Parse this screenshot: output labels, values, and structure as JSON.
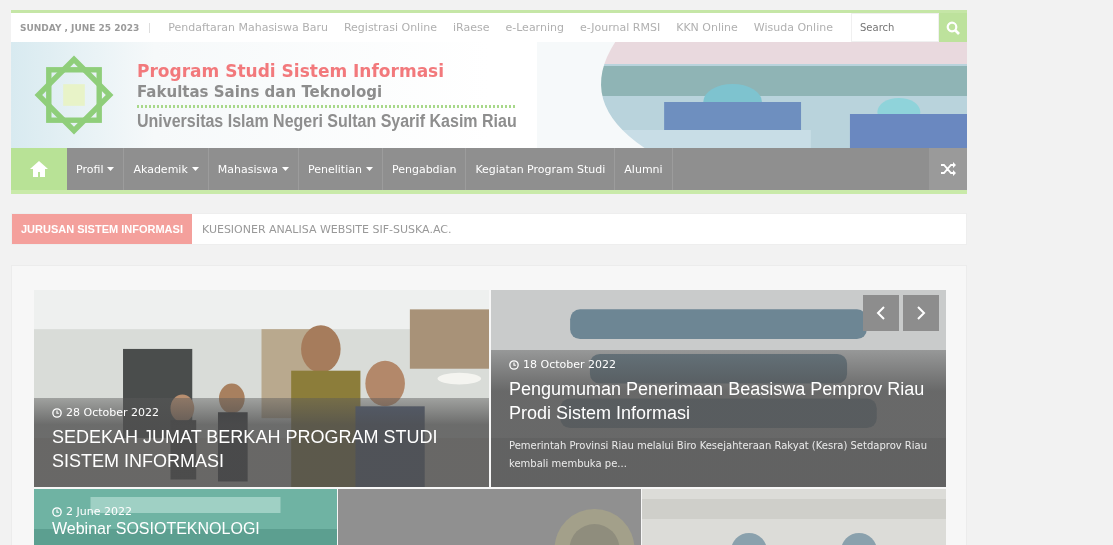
{
  "topbar": {
    "date": "SUNDAY , JUNE 25 2023",
    "links": [
      "Pendaftaran Mahasiswa Baru",
      "Registrasi Online",
      "iRaese",
      "e-Learning",
      "e-Journal RMSI",
      "KKN Online",
      "Wisuda Online"
    ],
    "search": {
      "placeholder": "Search"
    }
  },
  "header": {
    "title": "Program Studi Sistem Informasi",
    "faculty": "Fakultas Sains dan Teknologi",
    "university": "Universitas Islam Negeri Sultan Syarif Kasim Riau"
  },
  "nav": {
    "items": [
      {
        "label": "Profil",
        "dropdown": true
      },
      {
        "label": "Akademik",
        "dropdown": true
      },
      {
        "label": "Mahasiswa",
        "dropdown": true
      },
      {
        "label": "Penelitian",
        "dropdown": true
      },
      {
        "label": "Pengabdian",
        "dropdown": false
      },
      {
        "label": "Kegiatan Program Studi",
        "dropdown": false
      },
      {
        "label": "Alumni",
        "dropdown": false
      }
    ]
  },
  "ticker": {
    "label": "JURUSAN SISTEM INFORMASI",
    "text": "KUESIONER ANALISA WEBSITE SIF-SUSKA.AC."
  },
  "slider": {
    "posts": [
      {
        "kind": "people",
        "date": "28 October 2022",
        "title": "SEDEKAH JUMAT BERKAH PROGRAM STUDI SISTEM INFORMASI"
      },
      {
        "kind": "poster",
        "date": "18 October 2022",
        "title": "Pengumuman Penerimaan Beasiswa Pemprov Riau Prodi Sistem Informasi",
        "excerpt": "Pemerintah Provinsi Riau melalui Biro Kesejahteraan Rakyat (Kesra) Setdaprov Riau kembali membuka pe..."
      }
    ]
  },
  "tiles": [
    {
      "kind": "post",
      "date": "2 June 2022",
      "title": "Webinar SOSIOTEKNOLOGI"
    },
    {
      "kind": "picture"
    },
    {
      "kind": "picture"
    }
  ]
}
